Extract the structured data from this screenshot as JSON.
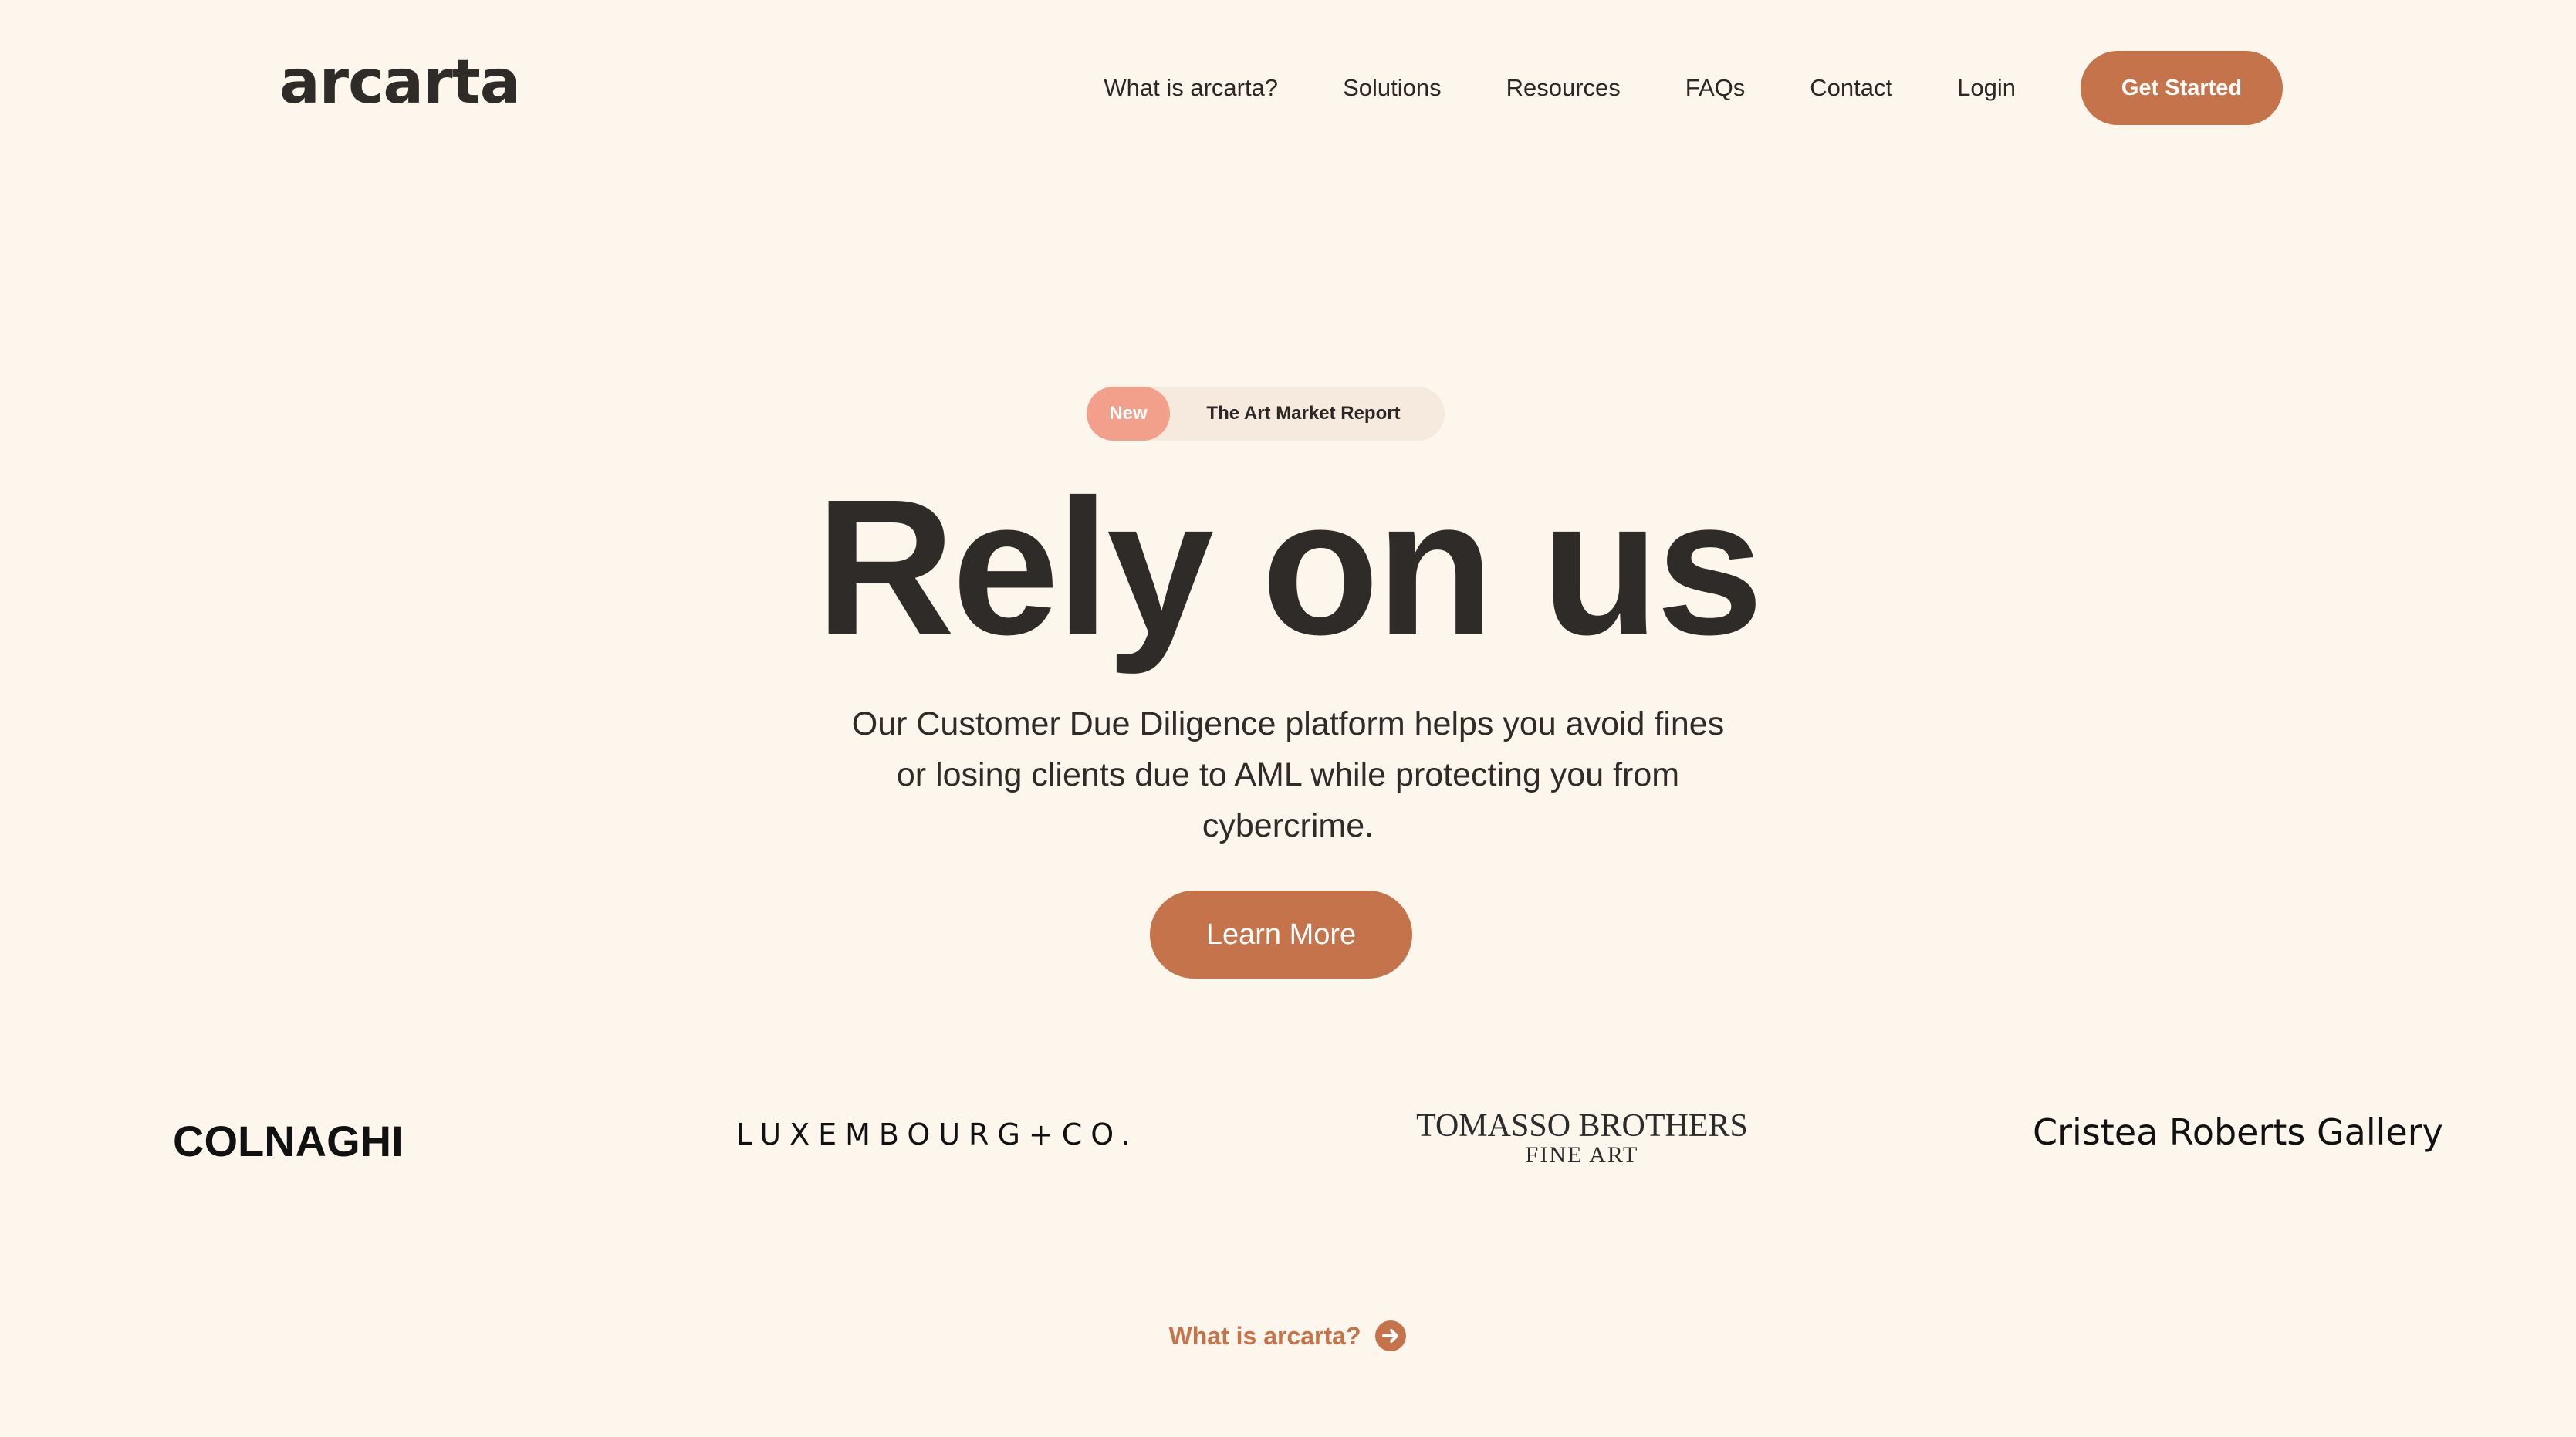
{
  "brand": {
    "logo_text": "arcarta",
    "accent_color": "#c4734a",
    "background_color": "#fdf6ed"
  },
  "nav": {
    "items": [
      {
        "label": "What is arcarta?"
      },
      {
        "label": "Solutions"
      },
      {
        "label": "Resources"
      },
      {
        "label": "FAQs"
      },
      {
        "label": "Contact"
      },
      {
        "label": "Login"
      }
    ],
    "cta_label": "Get Started"
  },
  "announcement": {
    "tag": "New",
    "text": "The Art Market Report"
  },
  "hero": {
    "title": "Rely on us",
    "subtitle": "Our Customer Due Diligence platform helps you avoid fines or losing clients due to AML while protecting you from cybercrime.",
    "cta_label": "Learn More"
  },
  "partners": {
    "colnaghi": "COLNAGHI",
    "luxembourg": "LUXEMBOURG+CO.",
    "tomasso_line1": "TOMASSO BROTHERS",
    "tomasso_line2": "FINE ART",
    "cristea": "Cristea Roberts Gallery"
  },
  "footer_link": {
    "label": "What is arcarta?",
    "icon": "arrow-right-circle-icon"
  }
}
